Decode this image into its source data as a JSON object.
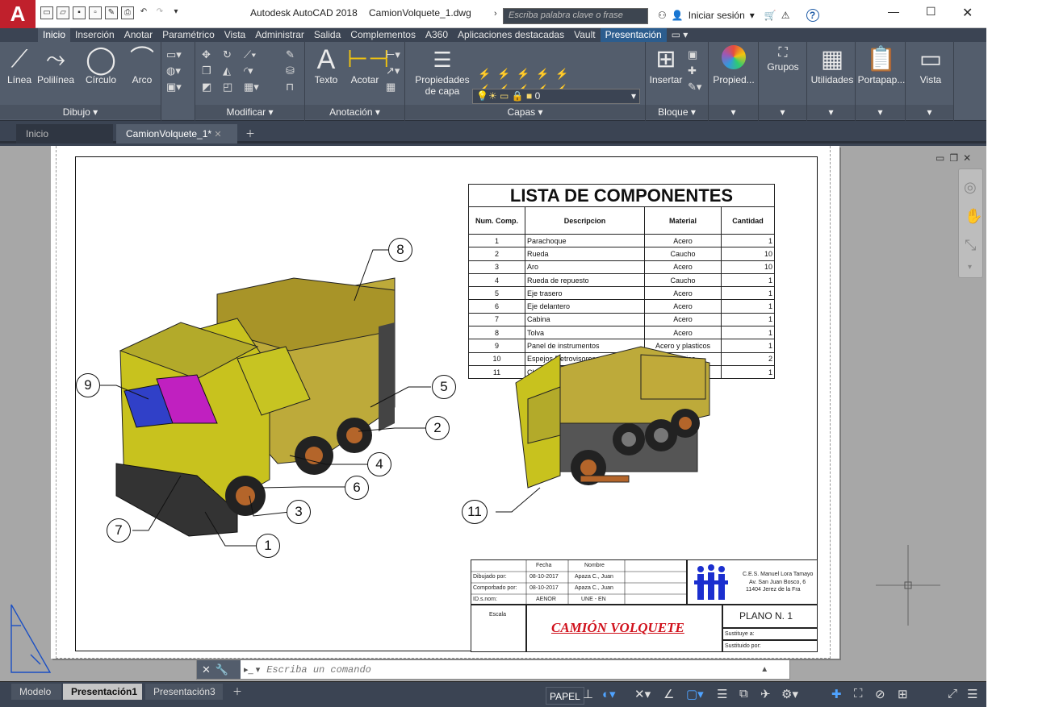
{
  "app": {
    "logo": "A",
    "title": "Autodesk AutoCAD 2018",
    "file": "CamionVolquete_1.dwg",
    "search_placeholder": "Escriba palabra clave o frase",
    "signin": "Iniciar sesión",
    "help": "?"
  },
  "ribbon_tabs": [
    "Inicio",
    "Inserción",
    "Anotar",
    "Paramétrico",
    "Vista",
    "Administrar",
    "Salida",
    "Complementos",
    "A360",
    "Aplicaciones destacadas",
    "Vault",
    "Presentación"
  ],
  "ribbon": {
    "dibujo": {
      "linea": "Línea",
      "polilinea": "Polilínea",
      "circulo": "Círculo",
      "arco": "Arco",
      "label": "Dibujo"
    },
    "modificar": {
      "label": "Modificar"
    },
    "anotacion": {
      "texto": "Texto",
      "acotar": "Acotar",
      "label": "Anotación"
    },
    "capas": {
      "propiedades": "Propiedades de capa",
      "layer_value": "0",
      "label": "Capas"
    },
    "bloque": {
      "insertar": "Insertar",
      "label": "Bloque"
    },
    "propied": "Propied...",
    "grupos": "Grupos",
    "utilidades": "Utilidades",
    "portapap": "Portapap...",
    "vista": "Vista"
  },
  "file_tabs": {
    "inicio": "Inicio",
    "current": "CamionVolquete_1*"
  },
  "parts_list": {
    "title": "LISTA DE COMPONENTES",
    "headers": [
      "Num. Comp.",
      "Descripcion",
      "Material",
      "Cantidad"
    ],
    "rows": [
      [
        "1",
        "Parachoque",
        "Acero",
        "1"
      ],
      [
        "2",
        "Rueda",
        "Caucho",
        "10"
      ],
      [
        "3",
        "Aro",
        "Acero",
        "10"
      ],
      [
        "4",
        "Rueda de repuesto",
        "Caucho",
        "1"
      ],
      [
        "5",
        "Eje trasero",
        "Acero",
        "1"
      ],
      [
        "6",
        "Eje delantero",
        "Acero",
        "1"
      ],
      [
        "7",
        "Cabina",
        "Acero",
        "1"
      ],
      [
        "8",
        "Tolva",
        "Acero",
        "1"
      ],
      [
        "9",
        "Panel de instrumentos",
        "Acero y plasticos",
        "1"
      ],
      [
        "10",
        "Espejos Retrovisores",
        "Plastico",
        "2"
      ],
      [
        "11",
        "Chasis",
        "Acero",
        "1"
      ]
    ]
  },
  "callouts": [
    "1",
    "2",
    "3",
    "4",
    "5",
    "6",
    "7",
    "8",
    "9",
    "11"
  ],
  "title_block": {
    "fecha": "Fecha",
    "nombre": "Nombre",
    "dibujado_label": "Dibujado por:",
    "dibujado_fecha": "08-10-2017",
    "dibujado_nombre": "Apaza C., Juan",
    "comprobado_label": "Comporbado por:",
    "comprobado_fecha": "08-10-2017",
    "comprobado_nombre": "Apaza C., Juan",
    "ids_label": "ID.s.nom:",
    "ids_1": "AENOR",
    "ids_2": "UNE - EN",
    "school_1": "C.E.S. Manuel Lora Tamayo",
    "school_2": "Av. San Juan Bosco, 6",
    "school_3": "11404 Jerez de la Fra",
    "escala": "Escala",
    "drawing_title": "CAMIÓN VOLQUETE",
    "plano": "PLANO N. 1",
    "sustituye": "Sustituye a:",
    "sustituido": "Sustituido por:"
  },
  "command": {
    "placeholder": "Escriba un comando"
  },
  "layout_tabs": [
    "Modelo",
    "Presentación1",
    "Presentación3"
  ],
  "status": {
    "papel": "PAPEL"
  }
}
